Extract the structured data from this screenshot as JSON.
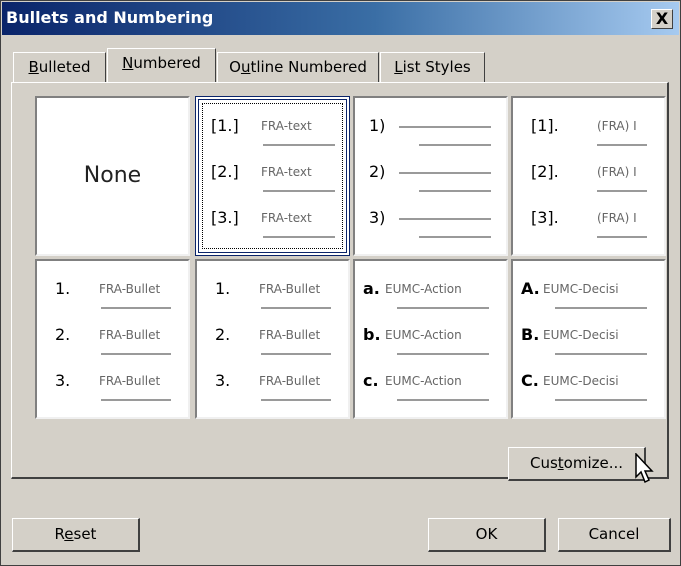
{
  "window": {
    "title": "Bullets and Numbering",
    "close_label": "X"
  },
  "tabs": [
    {
      "label": "Bulleted",
      "key": "B",
      "rest": "ulleted",
      "pre": ""
    },
    {
      "label": "Numbered",
      "key": "N",
      "rest": "umbered",
      "pre": ""
    },
    {
      "label": "Outline Numbered",
      "pre": "O",
      "key": "u",
      "rest": "tline Numbered"
    },
    {
      "label": "List Styles",
      "key": "L",
      "rest": "ist Styles",
      "pre": ""
    }
  ],
  "active_tab": "Numbered",
  "none_label": "None",
  "tiles": [
    {
      "labels": [
        "[1.]",
        "[2.]",
        "[3.]"
      ],
      "text": "FRA-text"
    },
    {
      "labels": [
        "1)",
        "2)",
        "3)"
      ],
      "text": ""
    },
    {
      "labels": [
        "[1].",
        "[2].",
        "[3]."
      ],
      "text": "(FRA) I"
    },
    {
      "labels": [
        "1.",
        "2.",
        "3."
      ],
      "text": "FRA-Bullet"
    },
    {
      "labels": [
        "1.",
        "2.",
        "3."
      ],
      "text": "FRA-Bullet"
    },
    {
      "labels": [
        "a.",
        "b.",
        "c."
      ],
      "text": "EUMC-Action"
    },
    {
      "labels": [
        "A.",
        "B.",
        "C."
      ],
      "text": "EUMC-Decisi"
    }
  ],
  "buttons": {
    "customize": {
      "pre": "Cus",
      "key": "t",
      "rest": "omize..."
    },
    "reset": {
      "pre": "R",
      "key": "e",
      "rest": "set"
    },
    "ok": "OK",
    "cancel": "Cancel"
  }
}
